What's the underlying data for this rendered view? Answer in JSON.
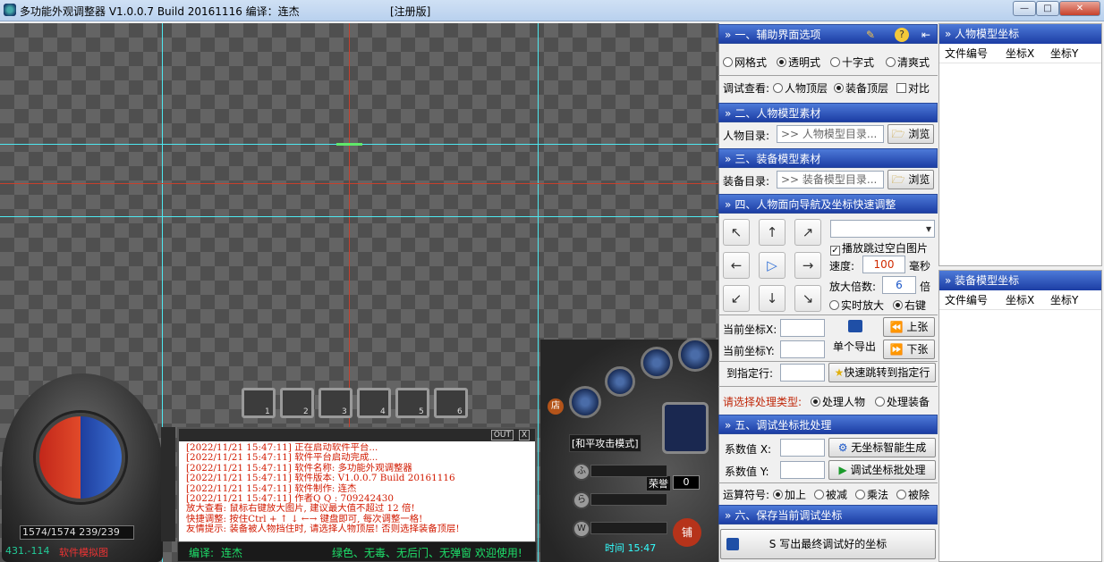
{
  "window": {
    "title": "多功能外观调整器 V1.0.0.7 Build 20161116  编译：连杰",
    "registered": "[注册版]",
    "min": "—",
    "max": "□",
    "close": "✕"
  },
  "hud": {
    "hp": "1574/1574  239/239",
    "coord": "431.-114",
    "sim_label": "软件模拟图",
    "belt_numbers": [
      "1",
      "2",
      "3",
      "4",
      "5",
      "6"
    ],
    "log_out": "OUT",
    "log_close": "X",
    "log_lines": [
      "[2022/11/21 15:47:11] 正在启动软件平台...",
      "[2022/11/21 15:47:11] 软件平台启动完成...",
      "[2022/11/21 15:47:11] 软件名称: 多功能外观调整器",
      "[2022/11/21 15:47:11] 软件版本: V1.0.0.7 Build 20161116",
      "[2022/11/21 15:47:11] 软件制作: 连杰",
      "[2022/11/21 15:47:11] 作者Q Q : 709242430",
      "放大查看: 鼠标右键放大图片, 建议最大值不超过 12 倍!",
      "快捷调整: 按住Ctrl + ↑ ↓ ←→ 键盘即可, 每次调整一格!",
      "友情提示: 装备被人物挡住时, 请选择人物顶层! 否则选择装备顶层!"
    ],
    "edit_label": "编译:",
    "edit_value": "连杰",
    "status_msg": "绿色、无毒、无后门、无弹窗  欢迎使用!",
    "mode": "[和平攻击模式]",
    "gold_label": "荣誉",
    "gold_value": "0",
    "time": "时间 15:47",
    "shop": "店",
    "pave": "铺",
    "skill_labels": [
      "ふ",
      "ら",
      "W"
    ]
  },
  "panel": {
    "sec1": {
      "title": "一、辅助界面选项",
      "modes": [
        "网格式",
        "透明式",
        "十字式",
        "清爽式"
      ],
      "selected_mode": 1,
      "debug_label": "调试查看:",
      "debug_opts": [
        "人物顶层",
        "装备顶层"
      ],
      "debug_selected": 1,
      "compare": "对比"
    },
    "sec2": {
      "title": "二、人物模型素材",
      "label": "人物目录:",
      "placeholder": ">> 人物模型目录...",
      "browse": "浏览"
    },
    "sec3": {
      "title": "三、装备模型素材",
      "label": "装备目录:",
      "placeholder": ">> 装备模型目录...",
      "browse": "浏览"
    },
    "sec4": {
      "title": "四、人物面向导航及坐标快速调整",
      "arrows": [
        "↖",
        "↑",
        "↗",
        "←",
        "▷",
        "→",
        "↙",
        "↓",
        "↘"
      ],
      "skip_blank": "播放跳过空白图片",
      "speed_label": "速度:",
      "speed_value": "100",
      "speed_unit": "毫秒",
      "zoom_label": "放大倍数:",
      "zoom_value": "6",
      "zoom_unit": "倍",
      "realtime": "实时放大",
      "rightkey": "右键",
      "cur_x": "当前坐标X:",
      "cur_y": "当前坐标Y:",
      "export_single": "单个导出",
      "prev": "上张",
      "next": "下张",
      "goto_label": "到指定行:",
      "goto_btn": "快速跳转到指定行",
      "type_label": "请选择处理类型:",
      "type_opts": [
        "处理人物",
        "处理装备"
      ],
      "type_selected": 0
    },
    "sec5": {
      "title": "五、调试坐标批处理",
      "coef_x": "系数值 X:",
      "coef_y": "系数值 Y:",
      "gen_btn": "无坐标智能生成",
      "batch_btn": "调试坐标批处理",
      "op_label": "运算符号:",
      "ops": [
        "加上",
        "被减",
        "乘法",
        "被除"
      ],
      "op_selected": 0
    },
    "sec6": {
      "title": "六、保存当前调试坐标",
      "save_btn": "S 写出最终调试好的坐标"
    }
  },
  "tables": {
    "char": {
      "title": "人物模型坐标",
      "cols": [
        "文件编号",
        "坐标X",
        "坐标Y"
      ]
    },
    "equip": {
      "title": "装备模型坐标",
      "cols": [
        "文件编号",
        "坐标X",
        "坐标Y"
      ]
    }
  },
  "colors": {
    "cyan_line": "#4ee8f0",
    "red_line": "#c8402c",
    "green_mark": "#5fe86a",
    "section_blue": "#1c3da4"
  }
}
